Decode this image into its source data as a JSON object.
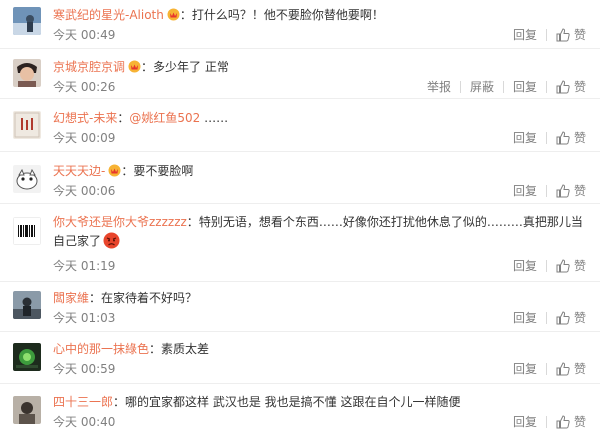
{
  "comments": [
    {
      "name": "寒武纪的星光-Alioth",
      "has_badge": true,
      "separator": "：",
      "body": "打什么吗？！他不要脸你替他要啊！",
      "time": "今天 00:49",
      "actions": {
        "report": "",
        "block": "",
        "reply": "回复",
        "like": "赞"
      }
    },
    {
      "name": "京城京腔京调",
      "has_badge": true,
      "separator": "：",
      "body": "多少年了 正常",
      "time": "今天 00:26",
      "actions": {
        "report": "举报",
        "block": "屏蔽",
        "reply": "回复",
        "like": "赞"
      }
    },
    {
      "name": "幻想式-未来",
      "has_badge": false,
      "separator": "：",
      "mention": "@姚红鱼502",
      "body": " ……",
      "time": "今天 00:09",
      "actions": {
        "reply": "回复",
        "like": "赞"
      }
    },
    {
      "name": "天天天边-",
      "has_badge": true,
      "separator": "：",
      "body": "要不要脸啊",
      "time": "今天 00:06",
      "actions": {
        "reply": "回复",
        "like": "赞"
      }
    },
    {
      "name": "你大爷还是你大爷zzzzzz",
      "has_badge": false,
      "separator": "：",
      "body": "特别无语，想看个东西……好像你还打扰他休息了似的………真把那儿当自己家了",
      "time": "今天 01:19",
      "actions": {
        "reply": "回复",
        "like": "赞"
      }
    },
    {
      "name": "闆家維",
      "has_badge": false,
      "separator": "：",
      "body": "在家待着不好吗？",
      "time": "今天 01:03",
      "actions": {
        "reply": "回复",
        "like": "赞"
      }
    },
    {
      "name": "心中的那一抹綠色",
      "has_badge": false,
      "separator": "：",
      "body": "素质太差",
      "time": "今天 00:59",
      "actions": {
        "reply": "回复",
        "like": "赞"
      }
    },
    {
      "name": "四十三一郎",
      "has_badge": false,
      "separator": "：",
      "body": "哪的宜家都这样 武汉也是 我也是搞不懂 这跟在自个儿一样随便",
      "time": "今天 00:40",
      "actions": {
        "reply": "回复",
        "like": "赞"
      }
    }
  ],
  "colors": {
    "name": "#eb7350",
    "meta": "#808080",
    "text": "#333333"
  }
}
